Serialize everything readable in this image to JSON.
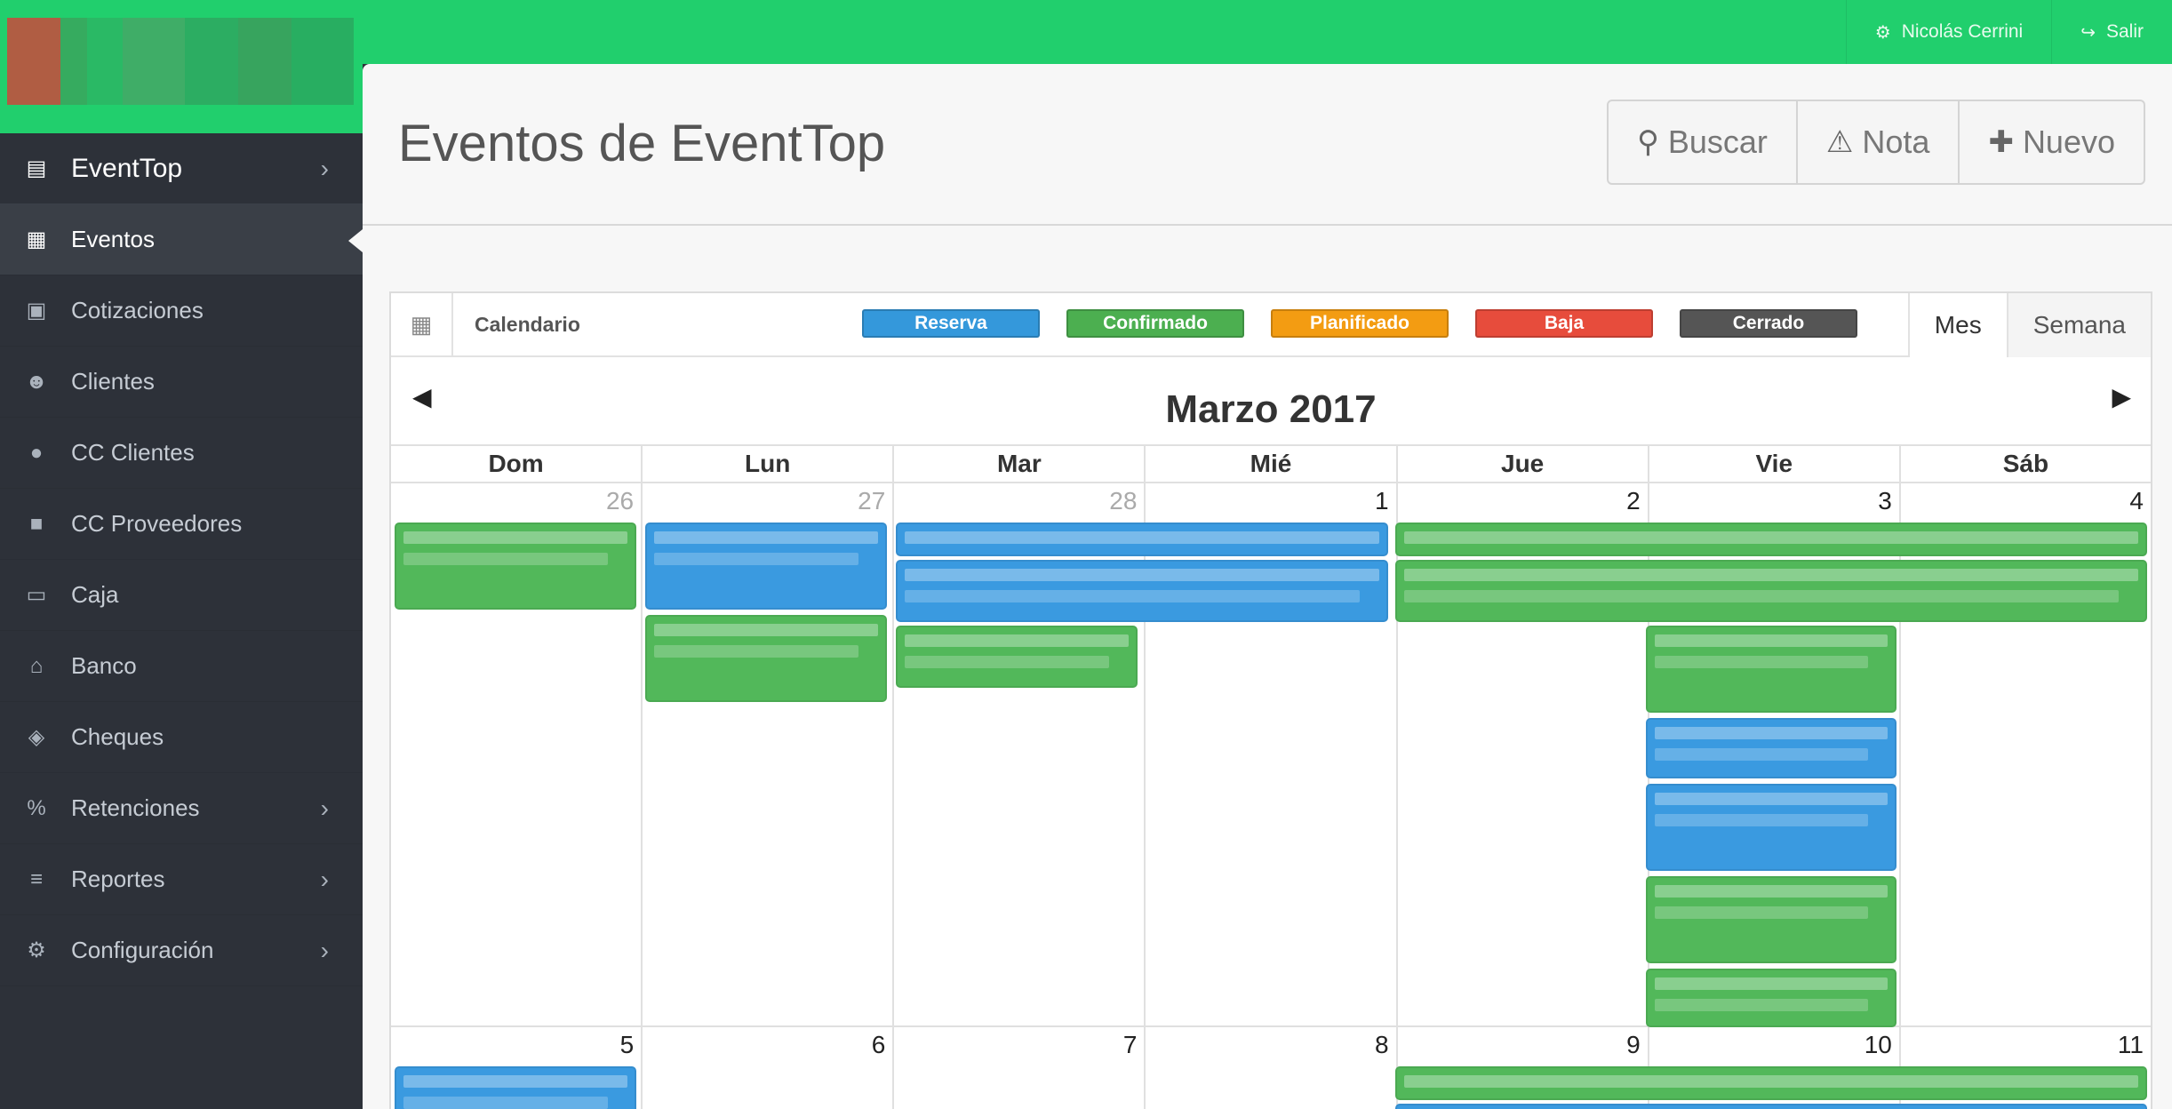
{
  "topbar": {
    "user_label": "Nicolás Cerrini",
    "logout_label": "Salir"
  },
  "sidebar": {
    "items": [
      {
        "label": "EventTop",
        "icon": "book-icon"
      },
      {
        "label": "Eventos",
        "icon": "calendar-icon"
      },
      {
        "label": "Cotizaciones",
        "icon": "calendar-plus-icon"
      },
      {
        "label": "Clientes",
        "icon": "users-icon"
      },
      {
        "label": "CC Clientes",
        "icon": "user-icon"
      },
      {
        "label": "CC Proveedores",
        "icon": "truck-icon"
      },
      {
        "label": "Caja",
        "icon": "money-icon"
      },
      {
        "label": "Banco",
        "icon": "bank-icon"
      },
      {
        "label": "Cheques",
        "icon": "ticket-icon"
      },
      {
        "label": "Retenciones",
        "icon": "percent-icon"
      },
      {
        "label": "Reportes",
        "icon": "list-icon"
      },
      {
        "label": "Configuración",
        "icon": "cogs-icon"
      }
    ]
  },
  "header": {
    "title": "Eventos de EventTop",
    "search_label": "Buscar",
    "note_label": "Nota",
    "new_label": "Nuevo"
  },
  "calendar": {
    "label": "Calendario",
    "legend": [
      {
        "label": "Reserva",
        "color": "#3498db"
      },
      {
        "label": "Confirmado",
        "color": "#4caf50"
      },
      {
        "label": "Planificado",
        "color": "#f39c12"
      },
      {
        "label": "Baja",
        "color": "#e74c3c"
      },
      {
        "label": "Cerrado",
        "color": "#555555"
      }
    ],
    "view_tabs": [
      "Mes",
      "Semana"
    ],
    "month_title": "Marzo 2017",
    "weekdays": [
      "Dom",
      "Lun",
      "Mar",
      "Mié",
      "Jue",
      "Vie",
      "Sáb"
    ],
    "weeks": [
      [
        "26",
        "27",
        "28",
        "1",
        "2",
        "3",
        "4"
      ],
      [
        "5",
        "6",
        "7",
        "8",
        "9",
        "10",
        "11"
      ]
    ]
  }
}
